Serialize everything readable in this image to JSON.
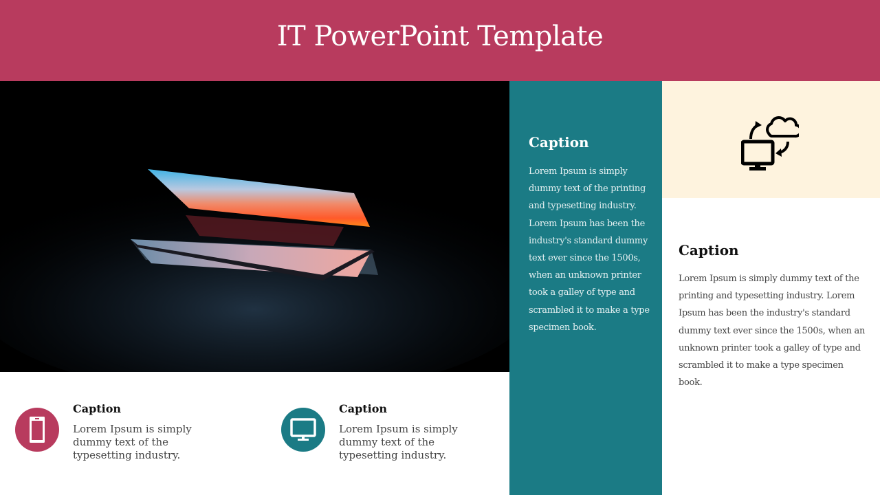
{
  "slide": {
    "title": "IT PowerPoint Template",
    "colors": {
      "header": "#b83b5e",
      "teal": "#1b7b85",
      "cream": "#fef3de",
      "white": "#ffffff"
    }
  },
  "photo": {
    "subject": "laptop-dark-lid-half-open-sunset-screen"
  },
  "teal_panel": {
    "caption": "Caption",
    "body": "Lorem Ipsum is simply dummy text of the printing and typesetting industry. Lorem Ipsum has been the industry's standard dummy text ever since the 1500s, when an unknown printer took a galley of type and scrambled it to make a type specimen book."
  },
  "cream_panel": {
    "icon": "computer-cloud-sync-icon"
  },
  "right_panel": {
    "caption": "Caption",
    "body": "Lorem Ipsum is simply dummy text of the printing and typesetting industry. Lorem Ipsum has been the industry's standard dummy text ever since the 1500s, when an unknown printer took a galley of type and scrambled it to make a type specimen book."
  },
  "features": [
    {
      "icon": "smartphone-icon",
      "color": "#b83b5e",
      "caption": "Caption",
      "body": "Lorem Ipsum is simply dummy text of the typesetting industry."
    },
    {
      "icon": "monitor-icon",
      "color": "#1b7b85",
      "caption": "Caption",
      "body": "Lorem Ipsum is simply dummy text of the typesetting industry."
    }
  ]
}
